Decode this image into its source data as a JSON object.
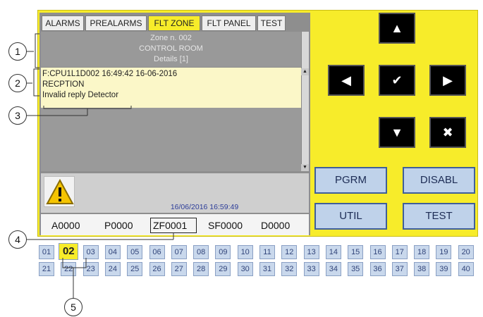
{
  "tabs": [
    "ALARMS",
    "PREALARMS",
    "FLT ZONE",
    "FLT PANEL",
    "TEST"
  ],
  "active_tab": "FLT ZONE",
  "zone": {
    "line1": "Zone n. 002",
    "line2": "CONTROL ROOM",
    "line3": "Details [1]"
  },
  "message": {
    "line1": "F:CPU1L1D002 16:49:42 16-06-2016",
    "line2": "RECPTION",
    "line3": "Invalid reply Detector"
  },
  "status": {
    "datetime": "16/06/2016 16:59:49"
  },
  "counters": [
    "A0000",
    "P0000",
    "ZF0001",
    "SF0000",
    "D0000"
  ],
  "nav_buttons": {
    "up": "▲",
    "left": "◀",
    "ok": "✔",
    "right": "▶",
    "down": "▼",
    "cancel": "✖"
  },
  "function_buttons": {
    "pgrm": "PGRM",
    "disabl": "DISABL",
    "util": "UTIL",
    "test": "TEST"
  },
  "zone_numbers_row1": [
    "01",
    "02",
    "03",
    "04",
    "05",
    "06",
    "07",
    "08",
    "09",
    "10",
    "11",
    "12",
    "13",
    "14",
    "15",
    "16",
    "17",
    "18",
    "19",
    "20"
  ],
  "zone_numbers_row2": [
    "21",
    "22",
    "23",
    "24",
    "25",
    "26",
    "27",
    "28",
    "29",
    "30",
    "31",
    "32",
    "33",
    "34",
    "35",
    "36",
    "37",
    "38",
    "39",
    "40"
  ],
  "selected_zone": "02",
  "callouts": [
    "1",
    "2",
    "3",
    "4",
    "5"
  ],
  "colors": {
    "panel_yellow": "#f7ec2a",
    "button_blue": "#bfd2ea",
    "date_blue": "#2c3d99"
  }
}
